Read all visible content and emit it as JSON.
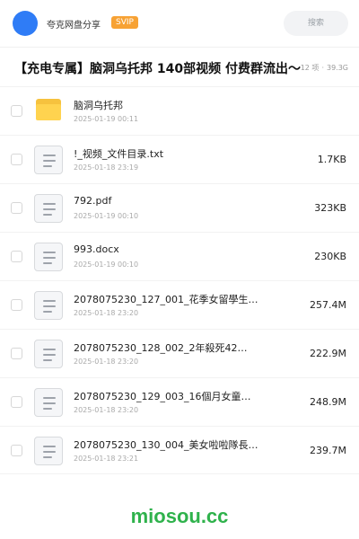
{
  "header": {
    "brand": "夸克网盘分享",
    "badge": "SVIP",
    "search_placeholder": "搜索"
  },
  "folder": {
    "title": "【充电专属】脑洞乌托邦 140部视频 付费群流出～",
    "item_count": "12 项",
    "total_size": "39.3G"
  },
  "items": [
    {
      "type": "folder",
      "name": "脑洞乌托邦",
      "date": "2025-01-19 00:11",
      "size": ""
    },
    {
      "type": "file",
      "name": "!_视频_文件目录.txt",
      "date": "2025-01-18 23:19",
      "size": "1.7KB"
    },
    {
      "type": "file",
      "name": "792.pdf",
      "date": "2025-01-19 00:10",
      "size": "323KB"
    },
    {
      "type": "file",
      "name": "993.docx",
      "date": "2025-01-19 00:10",
      "size": "230KB"
    },
    {
      "type": "file",
      "name": "2078075230_127_001_花季女留學生…",
      "date": "2025-01-18 23:20",
      "size": "257.4M"
    },
    {
      "type": "file",
      "name": "2078075230_128_002_2年殺死42…",
      "date": "2025-01-18 23:20",
      "size": "222.9M"
    },
    {
      "type": "file",
      "name": "2078075230_129_003_16個月女童…",
      "date": "2025-01-18 23:20",
      "size": "248.9M"
    },
    {
      "type": "file",
      "name": "2078075230_130_004_美女啦啦隊長…",
      "date": "2025-01-18 23:21",
      "size": "239.7M"
    }
  ],
  "footer": {
    "watermark": "miosou.cc"
  },
  "colors": {
    "accent": "#2f7cf6",
    "badge": "#f7a234",
    "folder": "#ffd34f",
    "watermark": "#2fb24c"
  }
}
